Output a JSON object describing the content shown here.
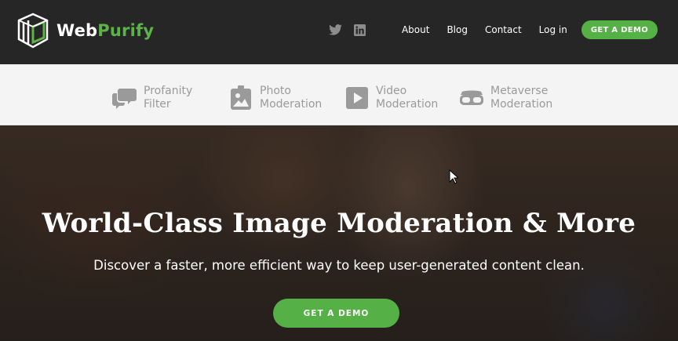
{
  "header": {
    "logo": {
      "part1": "Web",
      "part2": "Purify"
    },
    "social": [
      {
        "icon": "twitter-icon"
      },
      {
        "icon": "linkedin-icon"
      }
    ],
    "nav": [
      "About",
      "Blog",
      "Contact",
      "Log in"
    ],
    "cta": "GET A DEMO"
  },
  "subnav": {
    "items": [
      {
        "line1": "Profanity",
        "line2": "Filter",
        "icon": "chat-bubbles-icon"
      },
      {
        "line1": "Photo",
        "line2": "Moderation",
        "icon": "photo-icon"
      },
      {
        "line1": "Video",
        "line2": "Moderation",
        "icon": "play-icon"
      },
      {
        "line1": "Metaverse",
        "line2": "Moderation",
        "icon": "vr-headset-icon"
      }
    ]
  },
  "hero": {
    "title": "World-Class Image Moderation & More",
    "subtitle": "Discover a faster, more efficient way to keep user-generated content clean.",
    "cta": "GET A DEMO"
  },
  "colors": {
    "brand_green": "#55b046",
    "header_bg": "#262626",
    "subnav_bg": "#f4f4f4",
    "subnav_text": "#9a9a9a"
  }
}
